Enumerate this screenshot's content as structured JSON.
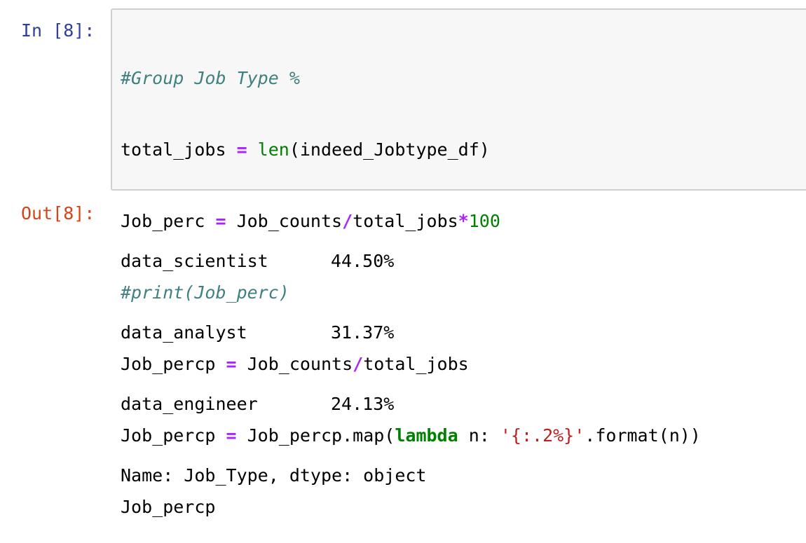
{
  "cell": {
    "in_prompt": "In [8]:",
    "out_prompt": "Out[8]:",
    "code": {
      "line1_comment": "#Group Job Type %",
      "line2_var": "total_jobs",
      "line2_op": " = ",
      "line2_builtin": "len",
      "line2_rest": "(indeed_Jobtype_df)",
      "line3_var": "Job_perc",
      "line3_op1": " = ",
      "line3_mid": "Job_counts",
      "line3_op2": "/",
      "line3_mid2": "total_jobs",
      "line3_op3": "*",
      "line3_num": "100",
      "line4_comment": "#print(Job_perc)",
      "line5_var": "Job_percp",
      "line5_op1": " = ",
      "line5_mid": "Job_counts",
      "line5_op2": "/",
      "line5_rest": "total_jobs",
      "line6_var": "Job_percp",
      "line6_op": " = ",
      "line6_call": "Job_percp.map(",
      "line6_keyword": "lambda",
      "line6_arg": " n: ",
      "line6_string": "'{:.2%}'",
      "line6_rest": ".format(n))",
      "line7": "Job_percp"
    },
    "output": {
      "rows": [
        {
          "label": "data_scientist",
          "value": "44.50%"
        },
        {
          "label": "data_analyst",
          "value": "31.37%"
        },
        {
          "label": "data_engineer",
          "value": "24.13%"
        }
      ],
      "footer": "Name: Job_Type, dtype: object"
    }
  }
}
